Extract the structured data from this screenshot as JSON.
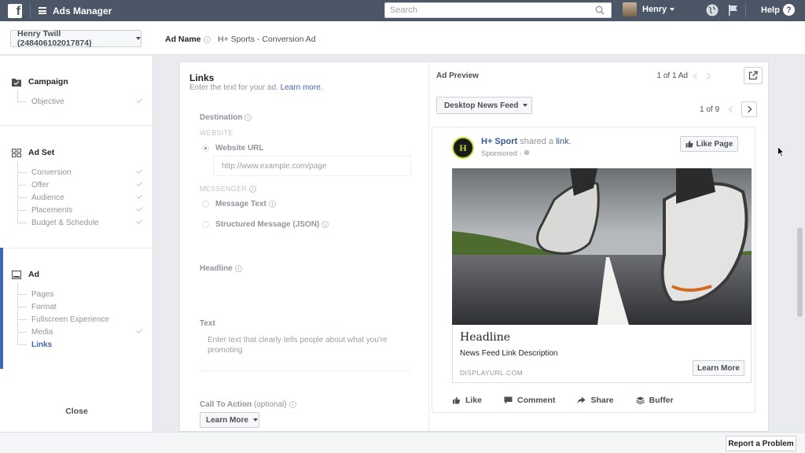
{
  "topbar": {
    "app_title": "Ads Manager",
    "search_placeholder": "Search",
    "user_name": "Henry",
    "help_label": "Help",
    "help_icon_glyph": "?",
    "icons": [
      "facebook-logo-icon",
      "menu-icon",
      "search-icon",
      "globe-icon",
      "flag-icon",
      "help-icon"
    ]
  },
  "subheader": {
    "account": "Henry Twill (248406102017874)",
    "ad_name_label": "Ad Name",
    "ad_name_value": "H+ Sports - Conversion Ad"
  },
  "sidebar": {
    "campaign": {
      "label": "Campaign",
      "items": [
        {
          "label": "Objective",
          "done": true
        }
      ]
    },
    "adset": {
      "label": "Ad Set",
      "items": [
        {
          "label": "Conversion",
          "done": true
        },
        {
          "label": "Offer",
          "done": true
        },
        {
          "label": "Audience",
          "done": true
        },
        {
          "label": "Placements",
          "done": true
        },
        {
          "label": "Budget & Schedule",
          "done": true
        }
      ]
    },
    "ad": {
      "label": "Ad",
      "items": [
        {
          "label": "Pages",
          "done": false
        },
        {
          "label": "Format",
          "done": false
        },
        {
          "label": "Fullscreen Experience",
          "done": false
        },
        {
          "label": "Media",
          "done": true
        },
        {
          "label": "Links",
          "done": false,
          "active": true
        }
      ]
    },
    "close_label": "Close"
  },
  "form": {
    "title": "Links",
    "description": "Enter the text for your ad.",
    "learn_more_link": "Learn more.",
    "destination_label": "Destination",
    "website_section": "WEBSITE",
    "website_url_label": "Website URL",
    "website_url_placeholder": "http://www.example.com/page",
    "messenger_section": "MESSENGER",
    "message_text_label": "Message Text",
    "structured_message_label": "Structured Message (JSON)",
    "headline_label": "Headline",
    "text_label": "Text",
    "text_placeholder": "Enter text that clearly tells people about what you're promoting",
    "cta_label": "Call To Action",
    "cta_optional": "(optional)",
    "cta_value": "Learn More"
  },
  "preview": {
    "title": "Ad Preview",
    "ad_count": "1 of 1 Ad",
    "placement": "Desktop News Feed",
    "placement_count": "1 of 9",
    "post": {
      "page_name": "H+ Sport",
      "shared_text": "shared a",
      "link_text": "link.",
      "sponsored": "Sponsored",
      "logo_text": "H",
      "like_page": "Like Page",
      "headline": "Headline",
      "link_description": "News Feed Link Description",
      "display_url": "DISPLAYURL.COM",
      "cta_button": "Learn More",
      "actions": [
        "Like",
        "Comment",
        "Share",
        "Buffer"
      ]
    }
  },
  "footer": {
    "report_label": "Report a Problem"
  },
  "colors": {
    "topbar": "#4b5766",
    "link": "#4267b2",
    "accent_bar": "#4267b2"
  }
}
